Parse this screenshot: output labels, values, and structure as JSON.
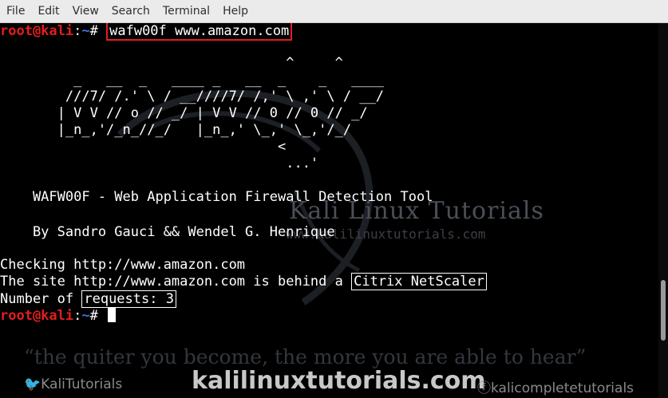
{
  "menubar": {
    "items": [
      "File",
      "Edit",
      "View",
      "Search",
      "Terminal",
      "Help"
    ]
  },
  "prompt": {
    "user": "root@kali",
    "sep": ":",
    "path": "~",
    "symbol": "#"
  },
  "command": "wafw00f www.amazon.com",
  "banner": {
    "art": [
      "                                   ^     ^",
      "         _   __  _   ____ _   __  _    _   ____",
      "        ///7/ /.' \\ / __////7/ /,' \\ ,' \\ / __/",
      "       | V V // o // _/ | V V // 0 // 0 // _/",
      "       |_n_,'/_n_//_/   |_n_,' \\_,' \\_,'/_/",
      "                                  <",
      "                                   ...'"
    ],
    "title": "    WAFW00F - Web Application Firewall Detection Tool",
    "author": "    By Sandro Gauci && Wendel G. Henrique"
  },
  "output": {
    "checking": "Checking http://www.amazon.com",
    "behind_prefix": "The site http://www.amazon.com is behind a ",
    "waf_name": "Citrix NetScaler",
    "requests_prefix": "Number of ",
    "requests": "requests: 3"
  },
  "watermark": {
    "title": "Kali Linux Tutorials",
    "url": "www.kalilinuxtutorials.com",
    "quote": "“the quiter you become, the more you are able to hear”",
    "site": "kalilinuxtutorials.com",
    "twitter": "KaliTutorials",
    "facebook": "kalicompletetutorials"
  }
}
